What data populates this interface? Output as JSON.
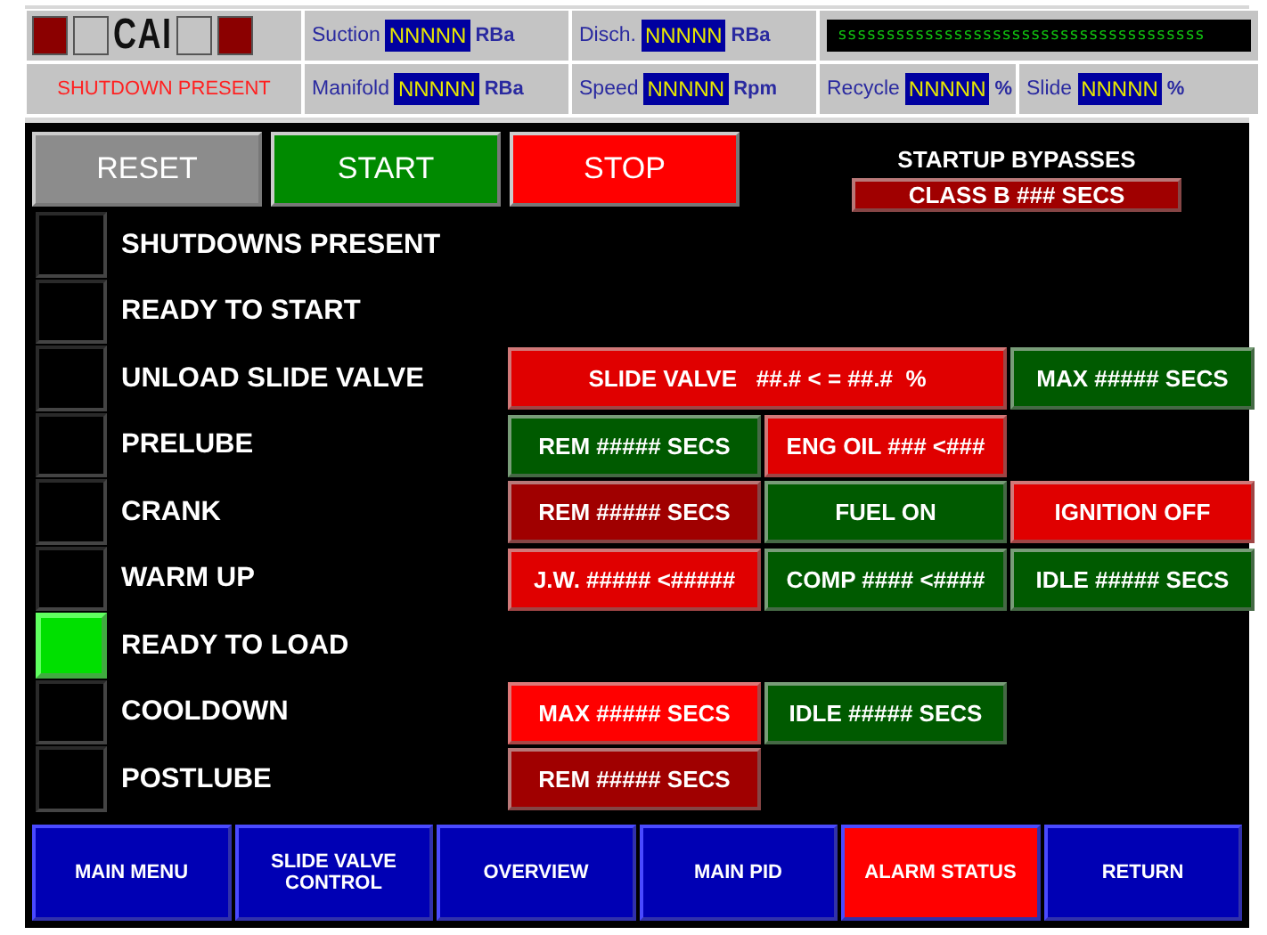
{
  "header": {
    "lamps_left": [
      {
        "color": "#8b0000"
      },
      {
        "color": "#c4c4c4"
      }
    ],
    "logo": "CAI",
    "lamps_right": [
      {
        "color": "#c4c4c4"
      },
      {
        "color": "#8b0000"
      }
    ],
    "alarm_text": "SHUTDOWN PRESENT",
    "fields": [
      {
        "label": "Suction",
        "value": "NNNNN",
        "unit": "RBa"
      },
      {
        "label": "Disch.",
        "value": "NNNNN",
        "unit": "RBa"
      },
      {
        "label": "Manifold",
        "value": "NNNNN",
        "unit": "RBa"
      },
      {
        "label": "Speed",
        "value": "NNNNN",
        "unit": "Rpm"
      },
      {
        "label": "Recycle",
        "value": "NNNNN",
        "unit": "%"
      },
      {
        "label": "Slide",
        "value": "NNNNN",
        "unit": "%"
      }
    ],
    "message": "ssssssssssssssssssssssssssssssssssssss"
  },
  "controls": [
    {
      "label": "RESET",
      "color": "#8c8c8c"
    },
    {
      "label": "START",
      "color": "#008a00"
    },
    {
      "label": "STOP",
      "color": "#ff0000"
    }
  ],
  "bypasses": {
    "title": "STARTUP BYPASSES",
    "button": {
      "label": "CLASS B ### SECS",
      "color": "#a00000"
    }
  },
  "sequence": [
    {
      "label": "SHUTDOWNS PRESENT",
      "on": false
    },
    {
      "label": "READY TO START",
      "on": false
    },
    {
      "label": "UNLOAD SLIDE VALVE",
      "on": false,
      "cells": [
        {
          "text": "SLIDE VALVE   ##.# < = ##.#  %",
          "color": "#e00000",
          "kind": "wide"
        },
        {
          "text": "MAX ##### SECS",
          "color": "#005a00",
          "kind": "normal"
        }
      ]
    },
    {
      "label": "PRELUBE",
      "on": false,
      "cells": [
        {
          "text": "REM ##### SECS",
          "color": "#005a00",
          "kind": "normal"
        },
        {
          "text": "ENG OIL ### <###",
          "color": "#e00000",
          "kind": "normal"
        }
      ]
    },
    {
      "label": "CRANK",
      "on": false,
      "cells": [
        {
          "text": "REM ##### SECS",
          "color": "#a00000",
          "kind": "normal"
        },
        {
          "text": "FUEL ON",
          "color": "#005a00",
          "kind": "normal"
        },
        {
          "text": "IGNITION OFF",
          "color": "#e00000",
          "kind": "normal"
        }
      ]
    },
    {
      "label": "WARM UP",
      "on": false,
      "cells": [
        {
          "text": "J.W. ##### <#####",
          "color": "#e00000",
          "kind": "normal"
        },
        {
          "text": "COMP #### <####",
          "color": "#005a00",
          "kind": "normal"
        },
        {
          "text": "IDLE ##### SECS",
          "color": "#005a00",
          "kind": "normal"
        }
      ]
    },
    {
      "label": "READY TO LOAD",
      "on": true
    },
    {
      "label": "COOLDOWN",
      "on": false,
      "cells": [
        {
          "text": "MAX ##### SECS",
          "color": "#ff0000",
          "kind": "normal"
        },
        {
          "text": "IDLE ##### SECS",
          "color": "#005a00",
          "kind": "normal"
        }
      ]
    },
    {
      "label": "POSTLUBE",
      "on": false,
      "cells": [
        {
          "text": "REM ##### SECS",
          "color": "#a00000",
          "kind": "normal"
        }
      ]
    }
  ],
  "nav": [
    {
      "label": "MAIN MENU",
      "color": "#0000b4"
    },
    {
      "label": "SLIDE VALVE CONTROL",
      "color": "#0000b4"
    },
    {
      "label": "OVERVIEW",
      "color": "#0000b4"
    },
    {
      "label": "MAIN PID",
      "color": "#0000b4"
    },
    {
      "label": "ALARM STATUS",
      "color": "#ff0000"
    },
    {
      "label": "RETURN",
      "color": "#0000b4"
    }
  ]
}
